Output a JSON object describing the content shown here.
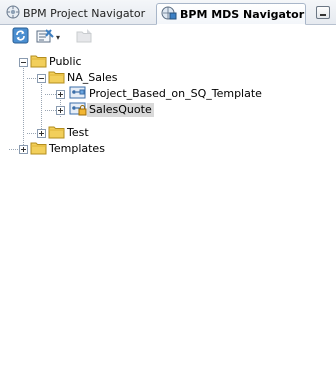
{
  "tabs": [
    {
      "label": "BPM Project Navigator",
      "icon": "project-navigator-icon",
      "active": false
    },
    {
      "label": "BPM MDS Navigator",
      "icon": "mds-navigator-icon",
      "active": true
    }
  ],
  "toolbar": {
    "buttons": [
      {
        "icon": "refresh-icon"
      },
      {
        "icon": "filter-dropdown-icon",
        "dropdown": "▾"
      },
      {
        "icon": "folder-action-icon",
        "enabled": false
      }
    ]
  },
  "tree": {
    "public": {
      "label": "Public",
      "expanded": true
    },
    "na_sales": {
      "label": "NA_Sales",
      "expanded": true
    },
    "project_template": {
      "label": "Project_Based_on_SQ_Template",
      "expanded": false
    },
    "sales_quote": {
      "label": "SalesQuote",
      "expanded": false,
      "selected": true
    },
    "test": {
      "label": "Test",
      "expanded": false
    },
    "templates": {
      "label": "Templates",
      "expanded": false
    }
  },
  "colors": {
    "folder": "#f2cf5b",
    "tab_border": "#a8b6c9",
    "selection": "#d9d9d9"
  }
}
